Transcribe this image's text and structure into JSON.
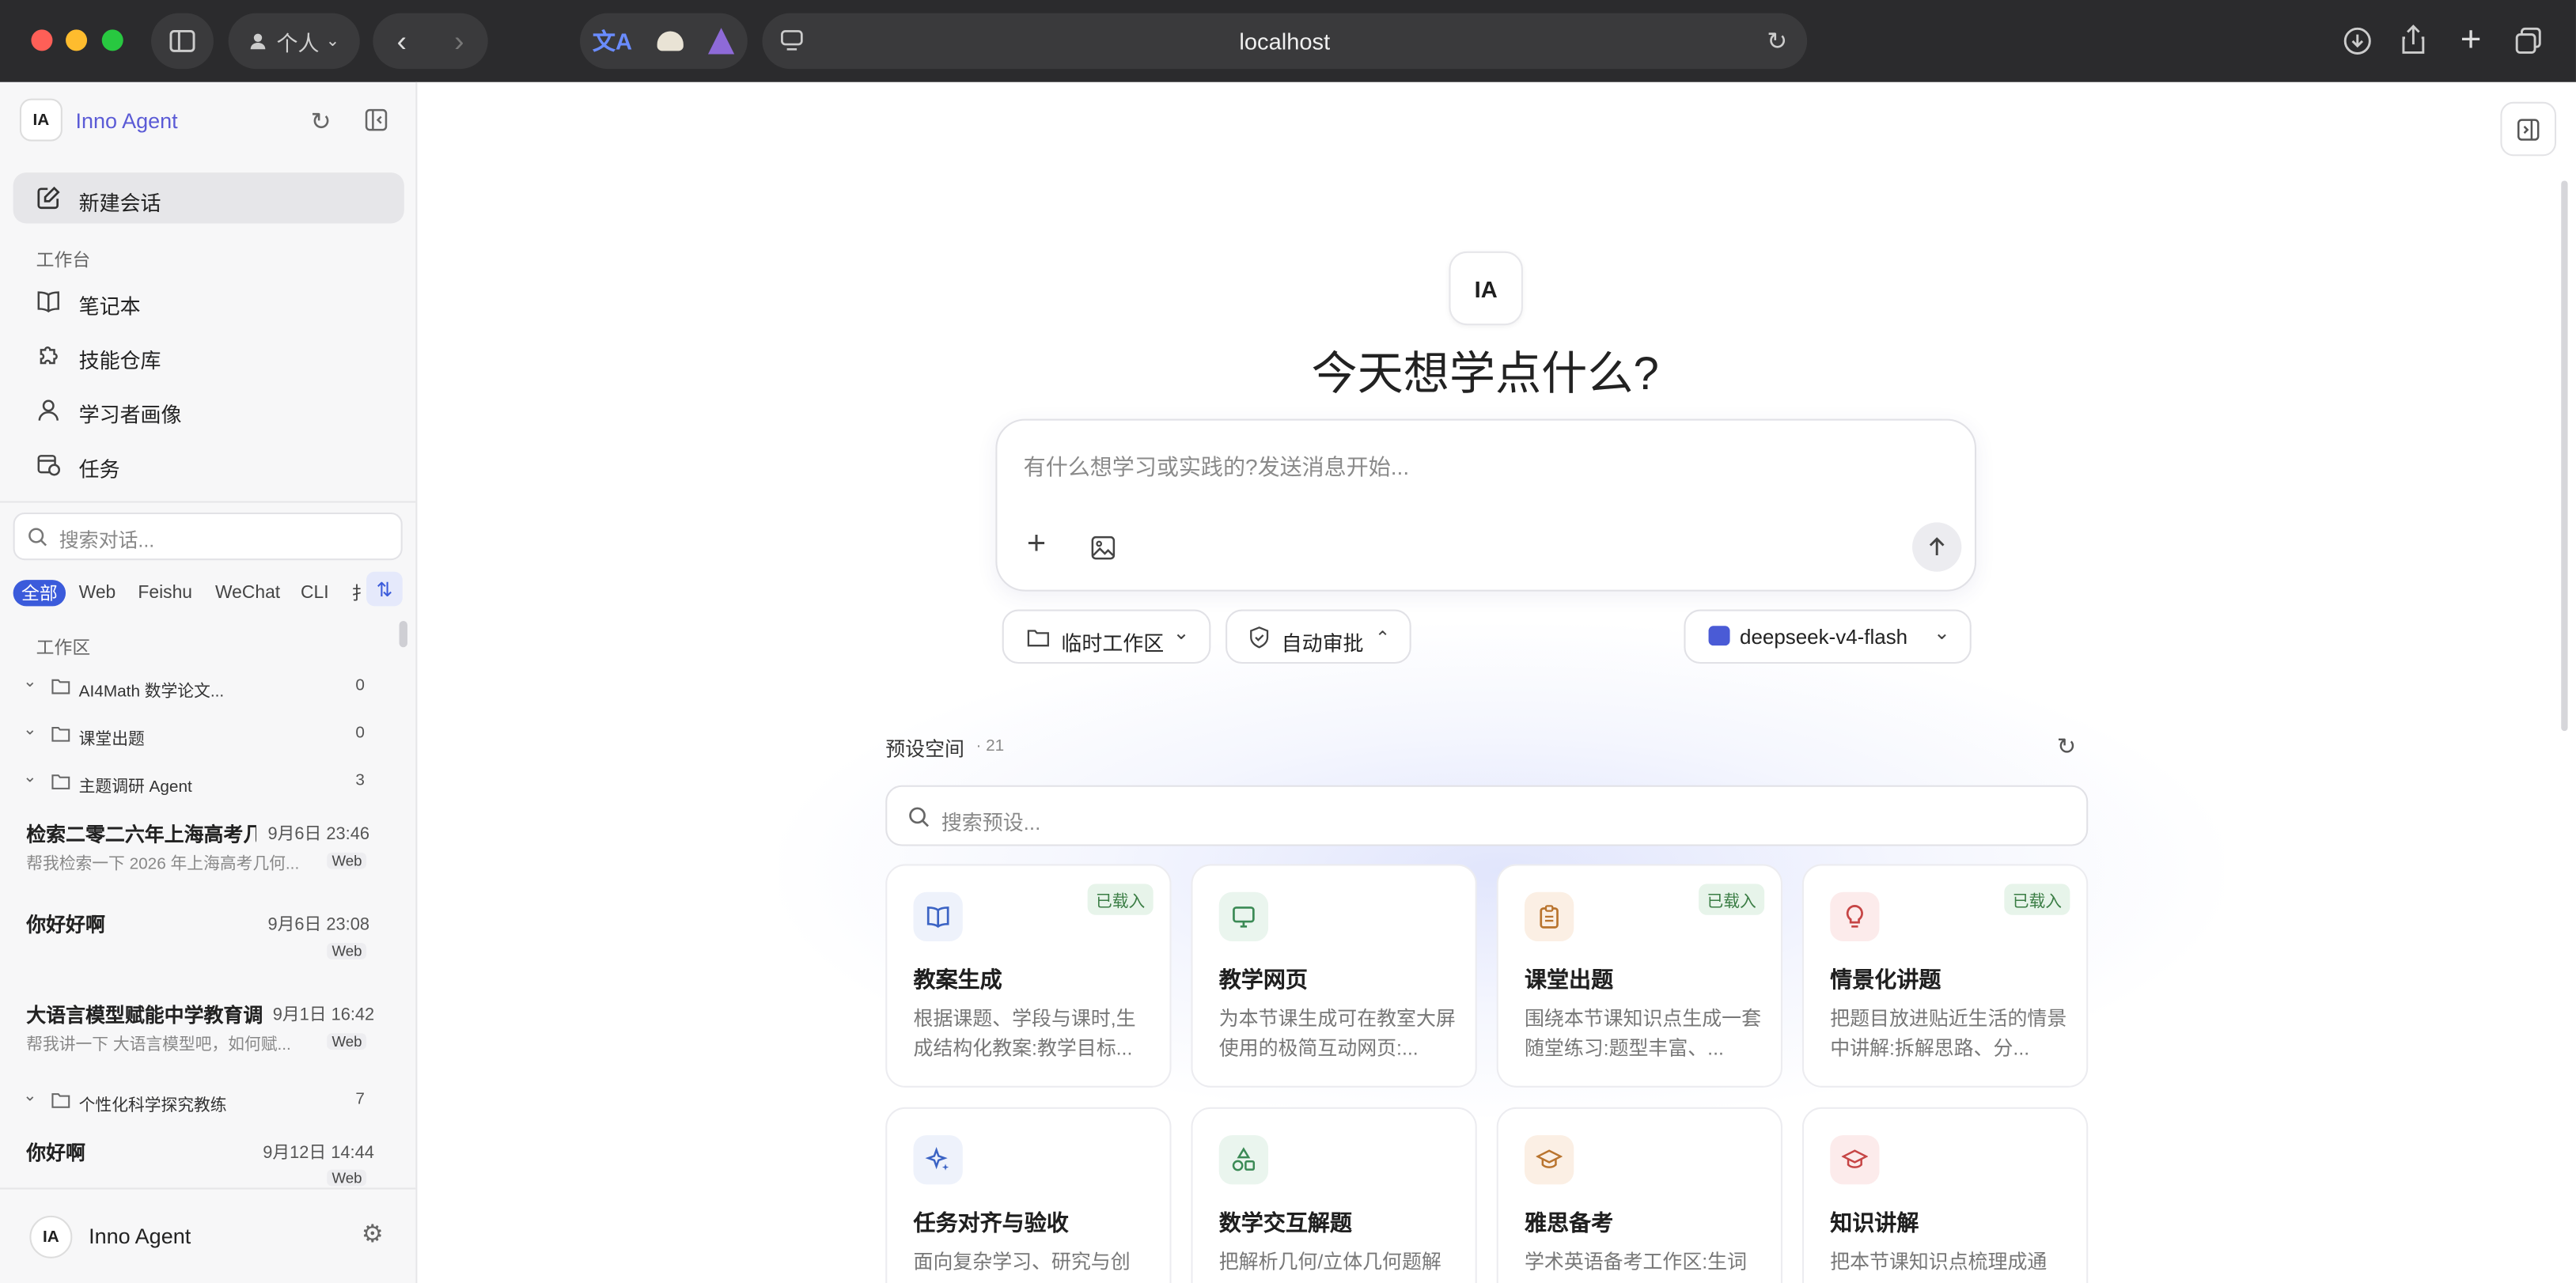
{
  "browser": {
    "url": "localhost",
    "profile": "个人"
  },
  "sidebar": {
    "app_name": "Inno Agent",
    "logo": "IA",
    "new_chat": "新建会话",
    "section_workbench": "工作台",
    "nav": [
      {
        "label": "笔记本",
        "icon": "book-icon"
      },
      {
        "label": "技能仓库",
        "icon": "puzzle-icon"
      },
      {
        "label": "学习者画像",
        "icon": "user-icon"
      },
      {
        "label": "任务",
        "icon": "calendar-clock-icon"
      }
    ],
    "search_placeholder": "搜索对话...",
    "filters": [
      "全部",
      "Web",
      "Feishu",
      "WeChat",
      "CLI",
      "扌"
    ],
    "section_workspace": "工作区",
    "folders": [
      {
        "name": "AI4Math 数学论文...",
        "count": "0"
      },
      {
        "name": "课堂出题",
        "count": "0"
      },
      {
        "name": "主题调研 Agent",
        "count": "3"
      },
      {
        "name": "个性化科学探究教练",
        "count": "7"
      }
    ],
    "chats": [
      {
        "title": "检索二零二六年上海高考几",
        "time": "9月6日 23:46",
        "preview": "帮我检索一下 2026 年上海高考几何...",
        "tag": "Web"
      },
      {
        "title": "你好好啊",
        "time": "9月6日 23:08",
        "preview": "",
        "tag": "Web"
      },
      {
        "title": "大语言模型赋能中学教育调",
        "time": "9月1日 16:42",
        "preview": "帮我讲一下 大语言模型吧，如何赋...",
        "tag": "Web"
      },
      {
        "title": "你好啊",
        "time": "9月12日 14:44",
        "preview": "",
        "tag": "Web"
      }
    ],
    "footer_name": "Inno Agent",
    "footer_logo": "IA"
  },
  "main": {
    "logo": "IA",
    "heading": "今天想学点什么?",
    "input_placeholder": "有什么想学习或实践的?发送消息开始...",
    "workspace_btn": "临时工作区",
    "approve_btn": "自动审批",
    "model_btn": "deepseek-v4-flash",
    "presets_title": "预设空间",
    "presets_count": "· 21",
    "presets_search": "搜索预设...",
    "cards": [
      {
        "title": "教案生成",
        "desc": "根据课题、学段与课时,生成结构化教案:教学目标...",
        "badge": "已载入",
        "icon": "book-open-icon",
        "color": "#eef2fb",
        "stroke": "#3b63c4"
      },
      {
        "title": "教学网页",
        "desc": "为本节课生成可在教室大屏使用的极简互动网页:...",
        "badge": "",
        "icon": "monitor-icon",
        "color": "#eaf5ee",
        "stroke": "#3b8a55"
      },
      {
        "title": "课堂出题",
        "desc": "围绕本节课知识点生成一套随堂练习:题型丰富、...",
        "badge": "已载入",
        "icon": "clipboard-icon",
        "color": "#fbefe4",
        "stroke": "#b9742e"
      },
      {
        "title": "情景化讲题",
        "desc": "把题目放进贴近生活的情景中讲解:拆解思路、分...",
        "badge": "已载入",
        "icon": "lightbulb-icon",
        "color": "#fcebeb",
        "stroke": "#c64545"
      },
      {
        "title": "任务对齐与验收",
        "desc": "面向复杂学习、研究与创",
        "badge": "",
        "icon": "sparkles-icon",
        "color": "#eef2fb",
        "stroke": "#3b63c4"
      },
      {
        "title": "数学交互解题",
        "desc": "把解析几何/立体几何题解",
        "badge": "",
        "icon": "shapes-icon",
        "color": "#eaf5ee",
        "stroke": "#3b8a55"
      },
      {
        "title": "雅思备考",
        "desc": "学术英语备考工作区:生词",
        "badge": "",
        "icon": "graduation-cap-icon",
        "color": "#fbefe4",
        "stroke": "#b9742e"
      },
      {
        "title": "知识讲解",
        "desc": "把本节课知识点梳理成通",
        "badge": "",
        "icon": "graduation-cap-icon",
        "color": "#fcebeb",
        "stroke": "#c64545"
      }
    ]
  }
}
